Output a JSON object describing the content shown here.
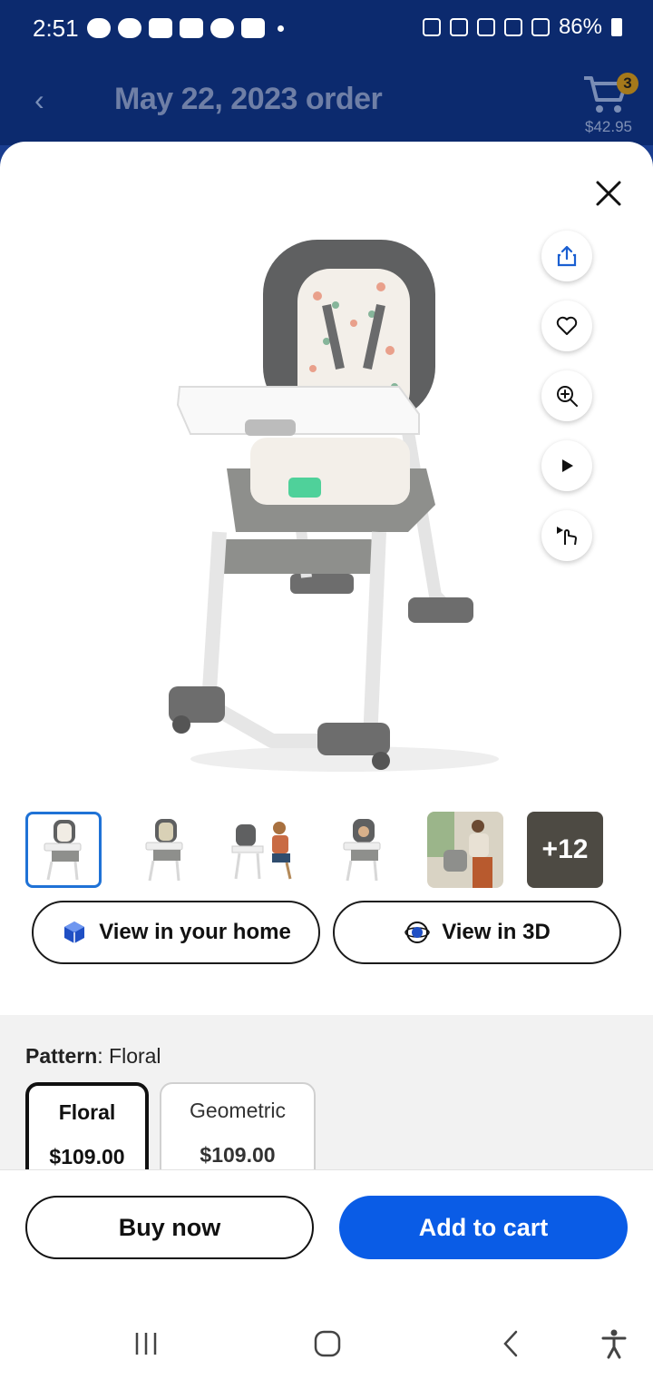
{
  "status_bar": {
    "time": "2:51",
    "battery": "86%"
  },
  "header": {
    "title": "May 22, 2023 order",
    "cart_count": "3",
    "cart_total": "$42.95"
  },
  "side_actions": [
    "share-icon",
    "heart-icon",
    "zoom-in-icon",
    "play-icon",
    "interactive-360-icon"
  ],
  "thumbnails": {
    "more_label": "+12"
  },
  "view_buttons": {
    "home_label": "View in your home",
    "threed_label": "View in 3D"
  },
  "pattern": {
    "label": "Pattern",
    "value": ": Floral"
  },
  "variants": [
    {
      "name": "Floral",
      "price": "$109.00",
      "selected": true
    },
    {
      "name": "Geometric",
      "price": "$109.00",
      "selected": false
    }
  ],
  "actions": {
    "buy_now": "Buy now",
    "add_to_cart": "Add to cart"
  },
  "colors": {
    "primary_blue": "#0a5ce6",
    "header_blue": "#0c2a6e",
    "selected_border": "#1f72d6"
  }
}
